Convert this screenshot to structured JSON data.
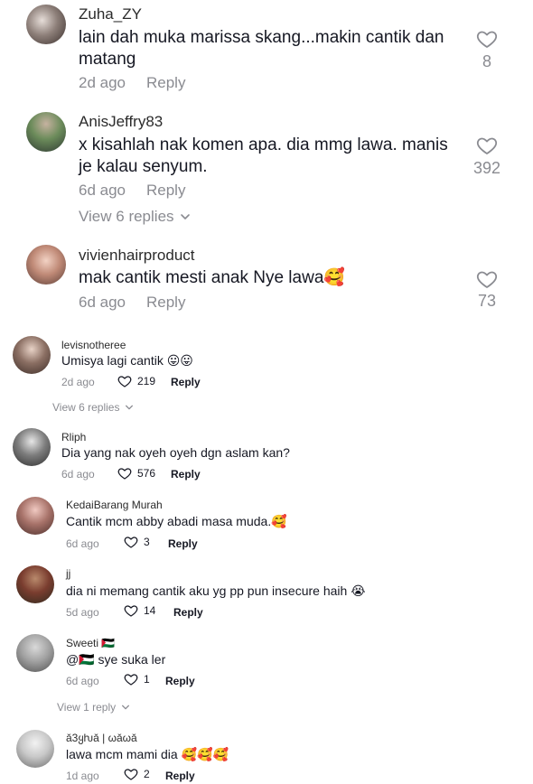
{
  "comments_top": [
    {
      "username": "Zuha_ZY",
      "text": "lain dah muka marissa skang...makin cantik dan matang",
      "time": "2d ago",
      "reply": "Reply",
      "likes": "8"
    },
    {
      "username": "AnisJeffry83",
      "text": "x kisahlah nak komen apa. dia mmg lawa. manis je kalau senyum.",
      "time": "6d ago",
      "reply": "Reply",
      "likes": "392",
      "view_replies": "View 6 replies"
    },
    {
      "username": "vivienhairproduct",
      "text": "mak cantik mesti anak Nye lawa🥰",
      "time": "6d ago",
      "reply": "Reply",
      "likes": "73"
    }
  ],
  "comments_bottom": [
    {
      "username": "levisnotheree",
      "text": "Umisya lagi cantik 😛😛",
      "time": "2d ago",
      "likes": "219",
      "reply": "Reply",
      "view_replies": "View 6 replies"
    },
    {
      "username": "Rliph",
      "text": "Dia yang nak oyeh oyeh dgn aslam kan?",
      "time": "6d ago",
      "likes": "576",
      "reply": "Reply"
    },
    {
      "username": "KedaiBarang Murah",
      "text": "Cantik mcm abby abadi masa muda.🥰",
      "time": "6d ago",
      "likes": "3",
      "reply": "Reply"
    },
    {
      "username": "jj",
      "text": "dia ni memang cantik aku yg pp pun insecure haih 😭",
      "time": "5d ago",
      "likes": "14",
      "reply": "Reply"
    },
    {
      "username": "Sweeti 🇵🇸",
      "text": "@🇵🇸 sye suka ler",
      "time": "6d ago",
      "likes": "1",
      "reply": "Reply",
      "view_replies": "View 1 reply"
    },
    {
      "username": "ǎ3ყƕǎ | ωǎωǎ",
      "text": "lawa mcm mami dia 🥰🥰🥰",
      "time": "1d ago",
      "likes": "2",
      "reply": "Reply"
    }
  ]
}
